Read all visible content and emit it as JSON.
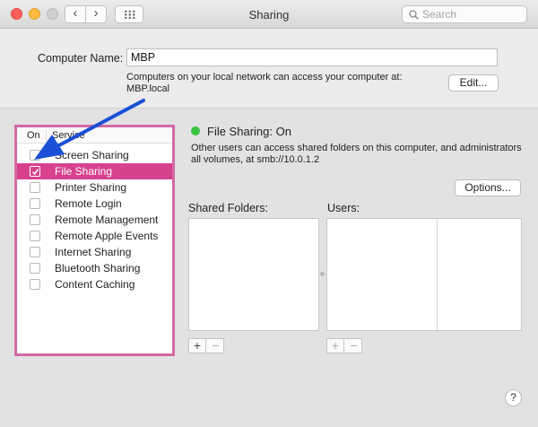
{
  "window": {
    "title": "Sharing",
    "back_glyph": "‹",
    "forward_glyph": "›",
    "search_placeholder": "Search"
  },
  "computer_name": {
    "label": "Computer Name:",
    "value": "MBP",
    "description_line1": "Computers on your local network can access your computer at:",
    "description_line2": "MBP.local",
    "edit_button": "Edit..."
  },
  "services": {
    "header_on": "On",
    "header_service": "Service",
    "items": [
      {
        "label": "Screen Sharing",
        "checked": false,
        "selected": false
      },
      {
        "label": "File Sharing",
        "checked": true,
        "selected": true
      },
      {
        "label": "Printer Sharing",
        "checked": false,
        "selected": false
      },
      {
        "label": "Remote Login",
        "checked": false,
        "selected": false
      },
      {
        "label": "Remote Management",
        "checked": false,
        "selected": false
      },
      {
        "label": "Remote Apple Events",
        "checked": false,
        "selected": false
      },
      {
        "label": "Internet Sharing",
        "checked": false,
        "selected": false
      },
      {
        "label": "Bluetooth Sharing",
        "checked": false,
        "selected": false
      },
      {
        "label": "Content Caching",
        "checked": false,
        "selected": false
      }
    ]
  },
  "detail": {
    "status": "File Sharing: On",
    "status_color": "#37c23f",
    "description_line1": "Other users can access shared folders on this computer, and administrators",
    "description_line2": "all volumes, at smb://10.0.1.2",
    "options_button": "Options...",
    "shared_folders_label": "Shared Folders:",
    "users_label": "Users:",
    "plus": "+",
    "minus": "−"
  },
  "help": "?",
  "colors": {
    "highlight": "#d6428e",
    "annotation_border": "#d36aa4",
    "annotation_arrow": "#1a4fd6"
  }
}
